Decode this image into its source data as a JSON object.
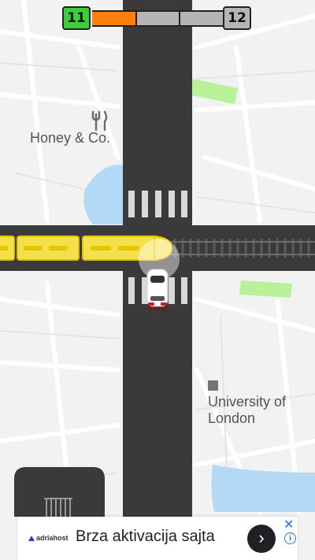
{
  "level": {
    "current": "11",
    "next": "12",
    "progress": 0.33,
    "colors": {
      "current": "#3ccf3c",
      "progress_fill": "#ff7f0e",
      "remaining": "#b5b5b5",
      "next": "#b5b5b5"
    }
  },
  "map": {
    "places": [
      {
        "label": "Honey & Co.",
        "icon": "fork-knife-icon"
      },
      {
        "label_line1": "University of",
        "label_line2": "London",
        "icon": "square-poi-icon"
      }
    ],
    "colors": {
      "road": "#3a3a3a",
      "background": "#f2f2f2",
      "park": "#b9f09a",
      "water": "#b3d9f5",
      "train": "#f4e04d",
      "train_stripe": "#e5c700",
      "car": "#ffffff",
      "car_tail": "#d81c1c"
    }
  },
  "ad": {
    "advertiser": "adriahost",
    "title": "Brza aktivacija sajta",
    "cta_icon": "chevron-right-icon",
    "close_icon": "close-icon",
    "info_icon": "info-icon"
  }
}
